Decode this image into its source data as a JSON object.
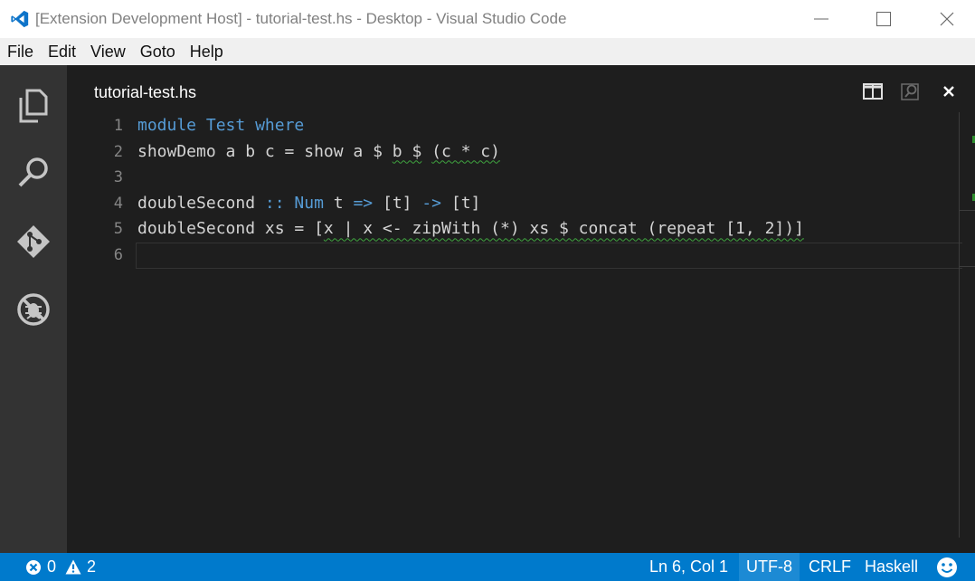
{
  "window": {
    "title": "[Extension Development Host] - tutorial-test.hs - Desktop - Visual Studio Code"
  },
  "menu": [
    "File",
    "Edit",
    "View",
    "Goto",
    "Help"
  ],
  "editor": {
    "tab_title": "tutorial-test.hs",
    "lines": [
      {
        "n": "1",
        "parts": [
          {
            "t": "module",
            "c": "kw"
          },
          {
            "t": " "
          },
          {
            "t": "Test",
            "c": "kw"
          },
          {
            "t": " "
          },
          {
            "t": "where",
            "c": "kw"
          }
        ]
      },
      {
        "n": "2",
        "parts": [
          {
            "t": "showDemo a b c = show a $ "
          },
          {
            "t": "b $",
            "c": "sq"
          },
          {
            "t": " "
          },
          {
            "t": "(c * c)",
            "c": "sq"
          }
        ]
      },
      {
        "n": "3",
        "parts": []
      },
      {
        "n": "4",
        "parts": [
          {
            "t": "doubleSecond "
          },
          {
            "t": "::",
            "c": "op"
          },
          {
            "t": " "
          },
          {
            "t": "Num",
            "c": "kw"
          },
          {
            "t": " t "
          },
          {
            "t": "=>",
            "c": "op"
          },
          {
            "t": " [t] "
          },
          {
            "t": "->",
            "c": "op"
          },
          {
            "t": " [t]"
          }
        ]
      },
      {
        "n": "5",
        "parts": [
          {
            "t": "doubleSecond xs = ["
          },
          {
            "t": "x | x <- zipWith (*) xs $ concat (repeat [1, 2])]",
            "c": "sq"
          }
        ]
      },
      {
        "n": "6",
        "parts": []
      }
    ],
    "current_line": 6
  },
  "status": {
    "errors": "0",
    "warnings": "2",
    "position": "Ln 6, Col 1",
    "encoding": "UTF-8",
    "eol": "CRLF",
    "language": "Haskell"
  },
  "icons": {
    "activity": [
      "files-icon",
      "search-icon",
      "git-icon",
      "debug-icon"
    ]
  },
  "colors": {
    "accent": "#007acc",
    "keyword": "#569cd6",
    "squiggle": "#3fa33f"
  }
}
